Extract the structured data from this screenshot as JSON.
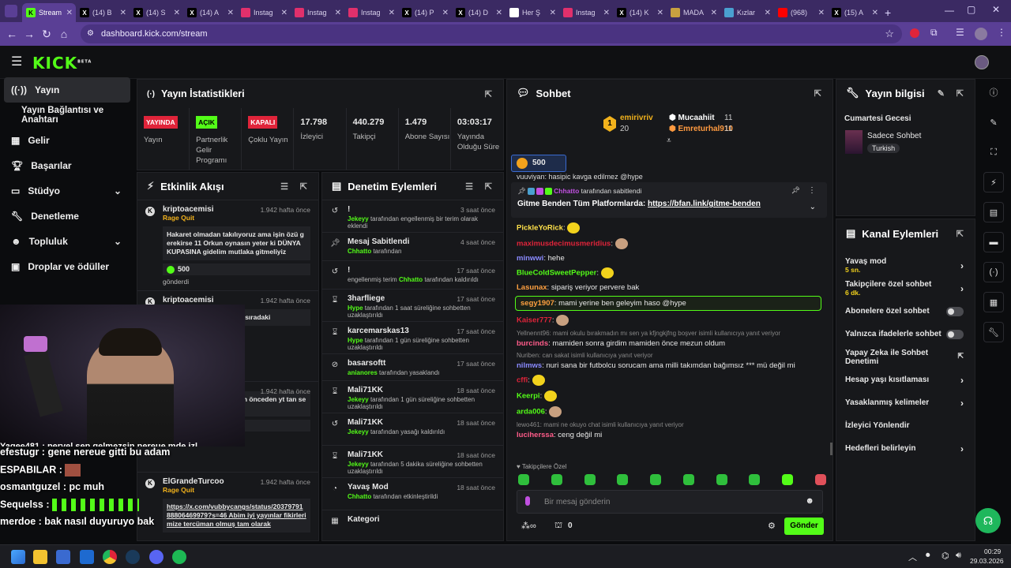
{
  "browser": {
    "tabs": [
      {
        "label": "Stream",
        "favicon": "kick",
        "color": "#53fc18",
        "active": true
      },
      {
        "label": "(14) B",
        "favicon": "x",
        "color": "#ffffff"
      },
      {
        "label": "(14) S",
        "favicon": "x",
        "color": "#ffffff"
      },
      {
        "label": "(14) A",
        "favicon": "x",
        "color": "#ffffff"
      },
      {
        "label": "Instag",
        "favicon": "instagram",
        "color": "#e1306c"
      },
      {
        "label": "Instag",
        "favicon": "instagram",
        "color": "#e1306c"
      },
      {
        "label": "Instag",
        "favicon": "instagram",
        "color": "#e1306c"
      },
      {
        "label": "(14) P",
        "favicon": "x",
        "color": "#ffffff"
      },
      {
        "label": "(14) D",
        "favicon": "x",
        "color": "#ffffff"
      },
      {
        "label": "Her Ş",
        "favicon": "tiktok",
        "color": "#ffffff"
      },
      {
        "label": "Instag",
        "favicon": "instagram",
        "color": "#e1306c"
      },
      {
        "label": "(14) K",
        "favicon": "x",
        "color": "#ffffff"
      },
      {
        "label": "MADA",
        "favicon": "site",
        "color": "#c8a040"
      },
      {
        "label": "Kızlar",
        "favicon": "site",
        "color": "#4aa0d0"
      },
      {
        "label": "(968)",
        "favicon": "youtube",
        "color": "#ff0000"
      },
      {
        "label": "(15) A",
        "favicon": "x",
        "color": "#ffffff"
      }
    ],
    "url": "dashboard.kick.com/stream"
  },
  "sidebar": {
    "items": [
      {
        "label": "Yayın",
        "icon": "broadcast-icon"
      },
      {
        "label": "Yayın Bağlantısı ve Anahtarı",
        "icon": ""
      },
      {
        "label": "Gelir",
        "icon": "revenue-icon"
      },
      {
        "label": "Başarılar",
        "icon": "trophy-icon"
      },
      {
        "label": "Stüdyo",
        "icon": "studio-icon"
      },
      {
        "label": "Denetleme",
        "icon": "wrench-icon"
      },
      {
        "label": "Topluluk",
        "icon": "community-icon"
      },
      {
        "label": "Droplar ve ödüller",
        "icon": "gift-icon"
      }
    ]
  },
  "stats": {
    "title": "Yayın İstatistikleri",
    "status": [
      {
        "badge": "YAYINDA",
        "label": "Yayın",
        "color": "#e0243a"
      },
      {
        "badge": "AÇIK",
        "label": "Partnerlik Gelir Programı",
        "color": "#53fc18"
      },
      {
        "badge": "KAPALI",
        "label": "Çoklu Yayın",
        "color": "#e0243a"
      }
    ],
    "metrics": [
      {
        "value": "17.798",
        "label": "İzleyici"
      },
      {
        "value": "440.279",
        "label": "Takipçi"
      },
      {
        "value": "1.479",
        "label": "Abone Sayısı"
      },
      {
        "value": "03:03:17",
        "label": "Yayında Olduğu Süre"
      }
    ]
  },
  "activity": {
    "title": "Etkinlik Akışı",
    "events": [
      {
        "user": "kriptoacemisi",
        "time": "1.942 hafta önce",
        "tag": "Rage Quit",
        "message": "Hakaret olmadan takılıyoruz ama işin özü gerekirse 11 Orkun oynasın yeter ki DÜNYA KUPASINA gidelim mutlaka gitmeliyiz",
        "amount": "500",
        "sent": "gönderdi"
      },
      {
        "user": "kriptoacemisi",
        "time": "1.942 hafta önce",
        "tag": "",
        "message": "neden oynamıyor acaba sıradaki",
        "amount": "",
        "sent": ""
      },
      {
        "user": "",
        "time": "1.942 hafta önce",
        "tag": "",
        "message": "sabı yeni açtım ve şladım önceden yt tan selamlar <3",
        "amount": "500",
        "sent": "gönderdi"
      },
      {
        "user": "ElGrandeTurcoo",
        "time": "1.942 hafta önce",
        "tag": "Rage Quit",
        "message": "https://x.com/vubbycangs/status/2037979188806469979?s=46 Abim iyi yayınlar fikirlerimize tercüman olmuş tam olarak",
        "amount": "",
        "sent": ""
      }
    ]
  },
  "moderation": {
    "title": "Denetim Eylemleri",
    "items": [
      {
        "title": "!",
        "time": "3 saat önce",
        "actor": "Jekeyy",
        "text": "tarafından engellenmiş bir terim olarak eklendi",
        "icon": "history-icon"
      },
      {
        "title": "Mesaj Sabitlendi",
        "time": "4 saat önce",
        "actor": "Chhatto",
        "text": "tarafından",
        "icon": "pin-icon"
      },
      {
        "title": "!",
        "time": "17 saat önce",
        "actor": "Chhatto",
        "pre": "engellenmiş terim",
        "text": "tarafından kaldırıldı",
        "icon": "history-icon"
      },
      {
        "title": "3harfliege",
        "time": "17 saat önce",
        "actor": "Hype",
        "text": "tarafından 1 saat süreliğine sohbetten uzaklaştırıldı",
        "icon": "hourglass-icon"
      },
      {
        "title": "karcemarskas13",
        "time": "17 saat önce",
        "actor": "Hype",
        "text": "tarafından 1 gün süreliğine sohbetten uzaklaştırıldı",
        "icon": "hourglass-icon"
      },
      {
        "title": "basarsoftt",
        "time": "17 saat önce",
        "actor": "anianores",
        "text": "tarafından yasaklandı",
        "icon": "ban-icon"
      },
      {
        "title": "Mali71KK",
        "time": "18 saat önce",
        "actor": "Jekeyy",
        "text": "tarafından 1 gün süreliğine sohbetten uzaklaştırıldı",
        "icon": "hourglass-icon"
      },
      {
        "title": "Mali71KK",
        "time": "18 saat önce",
        "actor": "Jekeyy",
        "text": "tarafından yasağı kaldırıldı",
        "icon": "history-icon"
      },
      {
        "title": "Mali71KK",
        "time": "18 saat önce",
        "actor": "Jekeyy",
        "text": "tarafından 5 dakika süreliğine sohbetten uzaklaştırıldı",
        "icon": "hourglass-icon"
      },
      {
        "title": "Yavaş Mod",
        "time": "18 saat önce",
        "actor": "Chhatto",
        "text": "tarafından etkinleştirildi",
        "icon": "slow-icon"
      },
      {
        "title": "Kategori",
        "time": "",
        "actor": "",
        "text": "",
        "icon": "category-icon"
      }
    ]
  },
  "chat": {
    "title": "Sohbet",
    "leaderboard": [
      {
        "rank": "1",
        "name": "emirivriv",
        "count": "20"
      },
      {
        "name": "Mucaahiit",
        "count": "11"
      },
      {
        "name": "Emreturhal910",
        "count": "11"
      }
    ],
    "kicks": "500",
    "cut_line": "vuuviyan: hasipic kavga edilmez @hype",
    "pinned": {
      "by": "Chhatto",
      "by_text": "tarafından sabitlendi",
      "text": "Gitme Benden Tüm Platformlarda: ",
      "link": "https://bfan.link/gitme-benden"
    },
    "messages": [
      {
        "user": "PickleYoRick",
        "color": "#ffe14a",
        "text": "",
        "emote": true
      },
      {
        "user": "maximusdecimusmeridius",
        "color": "#e0243a",
        "text": "",
        "emote": true
      },
      {
        "user": "minwwi",
        "color": "#8a8aff",
        "text": "hehe"
      },
      {
        "user": "BlueColdSweetPepper",
        "color": "#53fc18",
        "text": "",
        "emote": true
      },
      {
        "user": "Lasunax",
        "color": "#ffa040",
        "text": "sipariş veriyor pervere bak"
      },
      {
        "user": "segy1907",
        "color": "#ffa040",
        "text": "mami yerine ben geleyim haso @hype",
        "highlight": true
      },
      {
        "user": "Kaiser777",
        "color": "#e0243a",
        "text": "",
        "emote": true
      },
      {
        "reply": "Yellnennt96: mami okulu bırakmadın mı sen ya kfjngkjfng boşver isimli kullanıcıya yanıt veriyor",
        "user": "burcinds",
        "color": "#ff5c8a",
        "text": "mamiden sonra girdim mamiden önce mezun oldum"
      },
      {
        "reply": "Nuriben: can sakat isimli kullanıcıya yanıt veriyor",
        "user": "nilmws",
        "color": "#8a8aff",
        "text": "nuri sana bir futbolcu sorucam ama milli takımdan bağımsız *** mü değil mi"
      },
      {
        "user": "cffi",
        "color": "#e0243a",
        "text": "",
        "emote": true
      },
      {
        "user": "Keerpi",
        "color": "#53fc18",
        "text": "",
        "emote": true
      },
      {
        "user": "arda006",
        "color": "#53fc18",
        "text": "",
        "emote": true
      },
      {
        "reply": "lewo461: mami ne okuyo chat isimli kullanıcıya yanıt veriyor",
        "user": "luciherssa",
        "color": "#ff5c8a",
        "text": "ceng değil mi"
      }
    ],
    "followers_only": "Takipçilere Özel",
    "input_placeholder": "Bir mesaj gönderin",
    "send_label": "Gönder",
    "points": "0"
  },
  "stream_info": {
    "title": "Yayın bilgisi",
    "stream_title": "Cumartesi Gecesi",
    "category": "Sadece Sohbet",
    "language": "Turkish"
  },
  "channel_actions": {
    "title": "Kanal Eylemleri",
    "items": [
      {
        "label": "Yavaş mod",
        "value": "5 sn.",
        "type": "chevron"
      },
      {
        "label": "Takipçilere özel sohbet",
        "value": "6 dk.",
        "type": "chevron"
      },
      {
        "label": "Abonelere özel sohbet",
        "type": "toggle"
      },
      {
        "label": "Yalnızca ifadelerle sohbet",
        "type": "toggle"
      },
      {
        "label": "Yapay Zeka ile Sohbet Denetimi",
        "type": "external"
      },
      {
        "label": "Hesap yaşı kısıtlaması",
        "type": "chevron"
      },
      {
        "label": "Yasaklanmış kelimeler",
        "type": "chevron"
      },
      {
        "label": "İzleyici Yönlendir",
        "type": "none"
      },
      {
        "label": "Hedefleri belirleyin",
        "type": "chevron"
      }
    ]
  },
  "overlay_chat": [
    {
      "user": "Yagee481",
      "text": "pervel sen gelmezsin nereue mde izlemeye"
    },
    {
      "user": "efestugr",
      "text": "gene nereue gitti bu adam"
    },
    {
      "user": "ESPABILAR",
      "text": ""
    },
    {
      "user": "osmantguzel",
      "text": "pc muh"
    },
    {
      "user": "Sequelss",
      "text": ""
    },
    {
      "user": "merdoe",
      "text": "bak nasıl duyuruyo bak"
    }
  ],
  "taskbar": {
    "time": "00:29",
    "date": "29.03.2026"
  },
  "colors": {
    "accent": "#53fc18",
    "panel": "#17181b",
    "live": "#e0243a"
  }
}
